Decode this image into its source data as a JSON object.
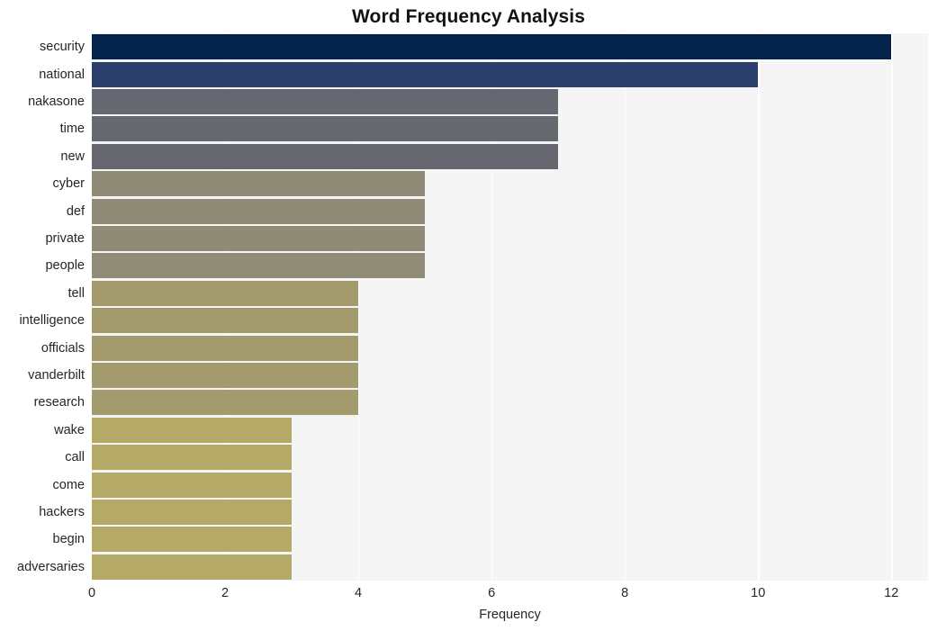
{
  "chart_data": {
    "type": "bar",
    "orientation": "horizontal",
    "title": "Word Frequency Analysis",
    "xlabel": "Frequency",
    "ylabel": "",
    "xlim": [
      0,
      12.55
    ],
    "xticks": [
      0,
      2,
      4,
      6,
      8,
      10,
      12
    ],
    "xtick_labels": [
      "0",
      "2",
      "4",
      "6",
      "8",
      "10",
      "12"
    ],
    "grid": true,
    "grid_axis": "x",
    "legend": null,
    "categories": [
      "security",
      "national",
      "nakasone",
      "time",
      "new",
      "cyber",
      "def",
      "private",
      "people",
      "tell",
      "intelligence",
      "officials",
      "vanderbilt",
      "research",
      "wake",
      "call",
      "come",
      "hackers",
      "begin",
      "adversaries"
    ],
    "values": [
      12,
      10,
      7,
      7,
      7,
      5,
      5,
      5,
      5,
      4,
      4,
      4,
      4,
      4,
      3,
      3,
      3,
      3,
      3,
      3
    ],
    "bar_colors": [
      "#04234c",
      "#2d3f6d",
      "#656771",
      "#66686f",
      "#66676e",
      "#908b76",
      "#908b76",
      "#908b77",
      "#918c77",
      "#a39a6d",
      "#a39a6d",
      "#a39a6d",
      "#a39a6d",
      "#a39a6d",
      "#b4a966",
      "#b4a966",
      "#b4a966",
      "#b4a966",
      "#b4a966",
      "#b4a966"
    ],
    "plot_background": "#f5f5f6",
    "grid_color": "#ffffff",
    "figure_background": "#ffffff"
  }
}
